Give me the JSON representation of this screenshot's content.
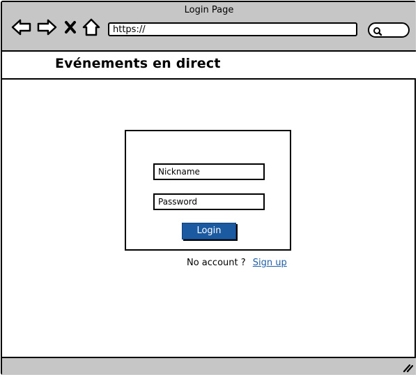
{
  "window": {
    "title": "Login Page"
  },
  "toolbar": {
    "icons": [
      "back-arrow-icon",
      "forward-arrow-icon",
      "close-x-icon",
      "home-icon"
    ],
    "url": "https://",
    "search_icon": "search-icon"
  },
  "header": {
    "title": "Evénements en direct"
  },
  "login": {
    "nickname_placeholder": "Nickname",
    "password_placeholder": "Password",
    "login_label": "Login",
    "button_color": "#1b5aa0"
  },
  "signup": {
    "prompt": "No account ?",
    "link": "Sign up",
    "link_color": "#1f5fa8"
  },
  "statusbar": {
    "icon": "resize-grip-icon"
  }
}
